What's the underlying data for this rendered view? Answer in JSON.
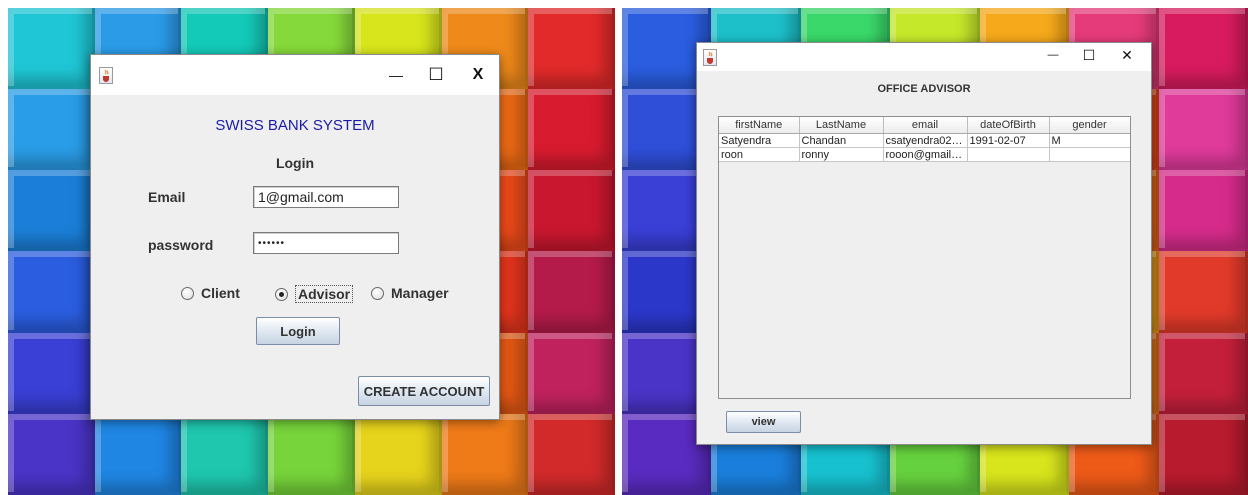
{
  "login_window": {
    "heading": "SWISS BANK SYSTEM",
    "subheading": "Login",
    "email_label": "Email",
    "email_value": "1@gmail.com",
    "password_label": "password",
    "password_mask": "••••••",
    "roles": [
      {
        "label": "Client",
        "selected": false
      },
      {
        "label": "Advisor",
        "selected": true
      },
      {
        "label": "Manager",
        "selected": false
      }
    ],
    "login_button": "Login",
    "create_account_button": "CREATE ACCOUNT",
    "controls": {
      "minimize": "—",
      "maximize": "☐",
      "close": "X"
    }
  },
  "advisor_window": {
    "heading": "OFFICE ADVISOR",
    "columns": [
      "firstName",
      "LastName",
      "email",
      "dateOfBirth",
      "gender"
    ],
    "rows": [
      [
        "Satyendra",
        "Chandan",
        "csatyendra02@...",
        "1991-02-07",
        "M"
      ],
      [
        "roon",
        "ronny",
        "rooon@gmail.c...",
        "",
        ""
      ]
    ],
    "view_button": "view",
    "controls": {
      "minimize": "—",
      "maximize": "☐",
      "close": "✕"
    }
  },
  "colors": {
    "heading_blue": "#1a1aa8",
    "window_bg": "#efefef",
    "button_border": "#7b8ea6"
  },
  "icons": [
    "java-cup-icon",
    "minimize-icon",
    "maximize-icon",
    "close-icon",
    "radio-icon"
  ]
}
